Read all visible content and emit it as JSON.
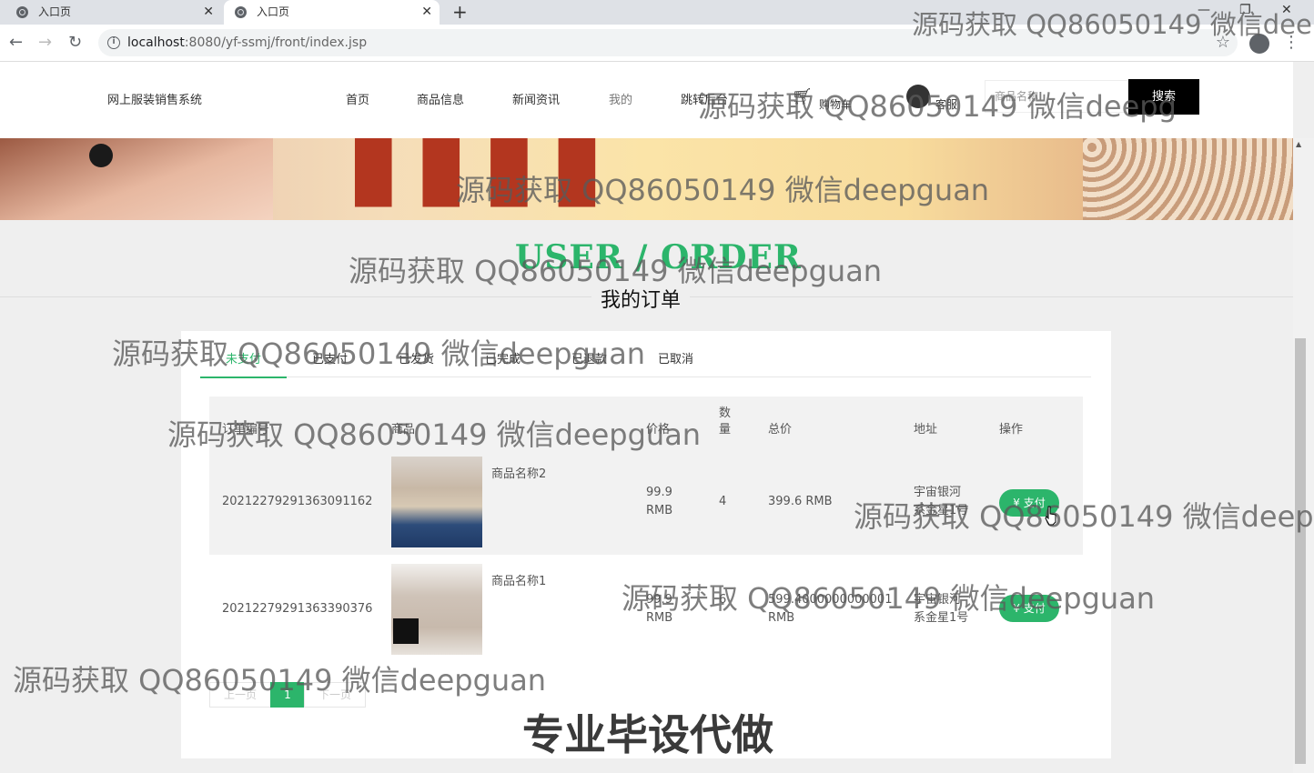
{
  "browser": {
    "tabs": [
      {
        "title": "入口页"
      },
      {
        "title": "入口页"
      }
    ],
    "new_tab": "+",
    "url_host": "localhost",
    "url_rest": ":8080/yf-ssmj/front/index.jsp",
    "controls": {
      "minimize": "—",
      "maximize": "❐",
      "close": "✕"
    }
  },
  "site": {
    "brand": "网上服装销售系统",
    "nav": [
      "首页",
      "商品信息",
      "新闻资讯",
      "我的",
      "跳转后台"
    ],
    "cart": "购物车",
    "service": "客服",
    "search_placeholder": "商品名称",
    "search_button": "搜索"
  },
  "section": {
    "title_en": "USER / ORDER",
    "title_cn": "我的订单"
  },
  "order_tabs": [
    {
      "label": "未支付",
      "active": true
    },
    {
      "label": "已支付"
    },
    {
      "label": "已发货"
    },
    {
      "label": "已完成"
    },
    {
      "label": "已退款"
    },
    {
      "label": "已取消"
    }
  ],
  "table": {
    "headers": {
      "order_no": "订单编号",
      "product": "商品",
      "price": "价格",
      "qty": "数量",
      "total": "总价",
      "address": "地址",
      "action": "操作"
    },
    "rows": [
      {
        "order_no": "20212279291363091162",
        "product": "商品名称2",
        "price": "99.9",
        "price_unit": "RMB",
        "qty": "4",
        "total": "399.6 RMB",
        "total_unit": "",
        "addr1": "宇宙银河",
        "addr2": "系金星1号",
        "action": "支付"
      },
      {
        "order_no": "20212279291363390376",
        "product": "商品名称1",
        "price": "99.9",
        "price_unit": "RMB",
        "qty": "6",
        "total": "599.4000000000001",
        "total_unit": "RMB",
        "addr1": "宇宙银河",
        "addr2": "系金星1号",
        "action": "支付"
      }
    ]
  },
  "pager": {
    "prev": "上一页",
    "current": "1",
    "next": "下一页"
  },
  "watermarks": {
    "small": "源码获取 QQ86050149 微信deepguan",
    "corner": "源码获取 QQ86050149 微信dee",
    "header": "源码获取 QQ86050149 微信deepg",
    "right": "源码获取 QQ86050149 微信deepgu",
    "big": "专业毕设代做"
  },
  "colors": {
    "accent": "#2cb56b",
    "search_btn": "#000000"
  }
}
